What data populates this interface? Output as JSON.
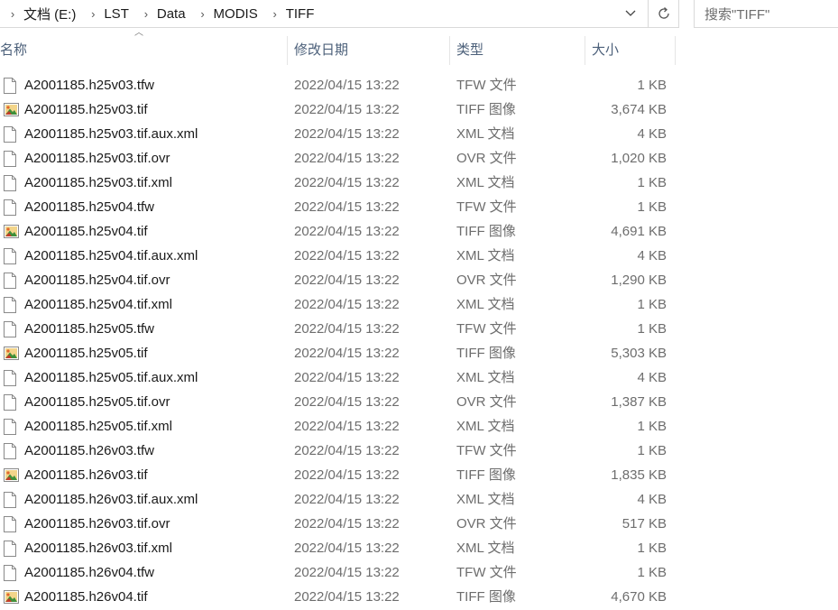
{
  "address": {
    "crumbs": [
      "文档 (E:)",
      "LST",
      "Data",
      "MODIS",
      "TIFF"
    ]
  },
  "search": {
    "placeholder": "搜索\"TIFF\""
  },
  "columns": {
    "name": "名称",
    "date": "修改日期",
    "type": "类型",
    "size": "大小"
  },
  "files": [
    {
      "name": "A2001185.h25v03.tfw",
      "date": "2022/04/15 13:22",
      "type": "TFW 文件",
      "size": "1 KB",
      "icon": "generic-file-icon"
    },
    {
      "name": "A2001185.h25v03.tif",
      "date": "2022/04/15 13:22",
      "type": "TIFF 图像",
      "size": "3,674 KB",
      "icon": "image-file-icon"
    },
    {
      "name": "A2001185.h25v03.tif.aux.xml",
      "date": "2022/04/15 13:22",
      "type": "XML 文档",
      "size": "4 KB",
      "icon": "generic-file-icon"
    },
    {
      "name": "A2001185.h25v03.tif.ovr",
      "date": "2022/04/15 13:22",
      "type": "OVR 文件",
      "size": "1,020 KB",
      "icon": "generic-file-icon"
    },
    {
      "name": "A2001185.h25v03.tif.xml",
      "date": "2022/04/15 13:22",
      "type": "XML 文档",
      "size": "1 KB",
      "icon": "generic-file-icon"
    },
    {
      "name": "A2001185.h25v04.tfw",
      "date": "2022/04/15 13:22",
      "type": "TFW 文件",
      "size": "1 KB",
      "icon": "generic-file-icon"
    },
    {
      "name": "A2001185.h25v04.tif",
      "date": "2022/04/15 13:22",
      "type": "TIFF 图像",
      "size": "4,691 KB",
      "icon": "image-file-icon"
    },
    {
      "name": "A2001185.h25v04.tif.aux.xml",
      "date": "2022/04/15 13:22",
      "type": "XML 文档",
      "size": "4 KB",
      "icon": "generic-file-icon"
    },
    {
      "name": "A2001185.h25v04.tif.ovr",
      "date": "2022/04/15 13:22",
      "type": "OVR 文件",
      "size": "1,290 KB",
      "icon": "generic-file-icon"
    },
    {
      "name": "A2001185.h25v04.tif.xml",
      "date": "2022/04/15 13:22",
      "type": "XML 文档",
      "size": "1 KB",
      "icon": "generic-file-icon"
    },
    {
      "name": "A2001185.h25v05.tfw",
      "date": "2022/04/15 13:22",
      "type": "TFW 文件",
      "size": "1 KB",
      "icon": "generic-file-icon"
    },
    {
      "name": "A2001185.h25v05.tif",
      "date": "2022/04/15 13:22",
      "type": "TIFF 图像",
      "size": "5,303 KB",
      "icon": "image-file-icon"
    },
    {
      "name": "A2001185.h25v05.tif.aux.xml",
      "date": "2022/04/15 13:22",
      "type": "XML 文档",
      "size": "4 KB",
      "icon": "generic-file-icon"
    },
    {
      "name": "A2001185.h25v05.tif.ovr",
      "date": "2022/04/15 13:22",
      "type": "OVR 文件",
      "size": "1,387 KB",
      "icon": "generic-file-icon"
    },
    {
      "name": "A2001185.h25v05.tif.xml",
      "date": "2022/04/15 13:22",
      "type": "XML 文档",
      "size": "1 KB",
      "icon": "generic-file-icon"
    },
    {
      "name": "A2001185.h26v03.tfw",
      "date": "2022/04/15 13:22",
      "type": "TFW 文件",
      "size": "1 KB",
      "icon": "generic-file-icon"
    },
    {
      "name": "A2001185.h26v03.tif",
      "date": "2022/04/15 13:22",
      "type": "TIFF 图像",
      "size": "1,835 KB",
      "icon": "image-file-icon"
    },
    {
      "name": "A2001185.h26v03.tif.aux.xml",
      "date": "2022/04/15 13:22",
      "type": "XML 文档",
      "size": "4 KB",
      "icon": "generic-file-icon"
    },
    {
      "name": "A2001185.h26v03.tif.ovr",
      "date": "2022/04/15 13:22",
      "type": "OVR 文件",
      "size": "517 KB",
      "icon": "generic-file-icon"
    },
    {
      "name": "A2001185.h26v03.tif.xml",
      "date": "2022/04/15 13:22",
      "type": "XML 文档",
      "size": "1 KB",
      "icon": "generic-file-icon"
    },
    {
      "name": "A2001185.h26v04.tfw",
      "date": "2022/04/15 13:22",
      "type": "TFW 文件",
      "size": "1 KB",
      "icon": "generic-file-icon"
    },
    {
      "name": "A2001185.h26v04.tif",
      "date": "2022/04/15 13:22",
      "type": "TIFF 图像",
      "size": "4,670 KB",
      "icon": "image-file-icon"
    }
  ]
}
